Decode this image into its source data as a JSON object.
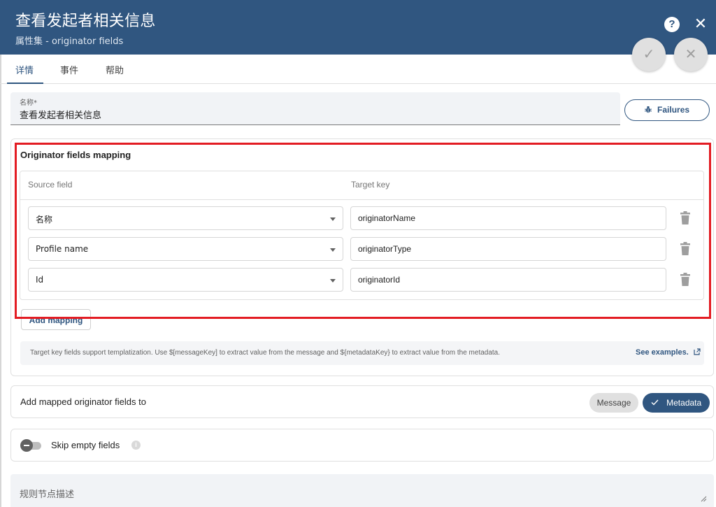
{
  "header": {
    "title": "查看发起者相关信息",
    "subtitle": "属性集 - originator fields",
    "help_icon": "?",
    "close_icon": "✕"
  },
  "actions": {
    "apply_icon": "✓",
    "discard_icon": "✕"
  },
  "tabs": [
    {
      "label": "详情",
      "active": true
    },
    {
      "label": "事件",
      "active": false
    },
    {
      "label": "帮助",
      "active": false
    }
  ],
  "name_field": {
    "label": "名称*",
    "value": "查看发起者相关信息"
  },
  "failures_button": {
    "icon": "bug-icon",
    "label": "Failures"
  },
  "mapping": {
    "title": "Originator fields mapping",
    "columns": [
      "Source field",
      "Target key"
    ],
    "rows": [
      {
        "source": "名称",
        "target": "originatorName"
      },
      {
        "source": "Profile name",
        "target": "originatorType"
      },
      {
        "source": "Id",
        "target": "originatorId"
      }
    ],
    "add_label": "Add mapping",
    "hint": "Target key fields support templatization. Use $[messageKey] to extract value from the message and ${metadataKey} to extract value from the metadata.",
    "examples_link": "See examples."
  },
  "add_to": {
    "label": "Add mapped originator fields to",
    "options": [
      "Message",
      "Metadata"
    ],
    "selected": "Metadata"
  },
  "skip_empty": {
    "label": "Skip empty fields",
    "enabled": false
  },
  "description": {
    "placeholder": "规则节点描述"
  },
  "colors": {
    "primary": "#305680",
    "highlight_border": "#e31c23"
  }
}
